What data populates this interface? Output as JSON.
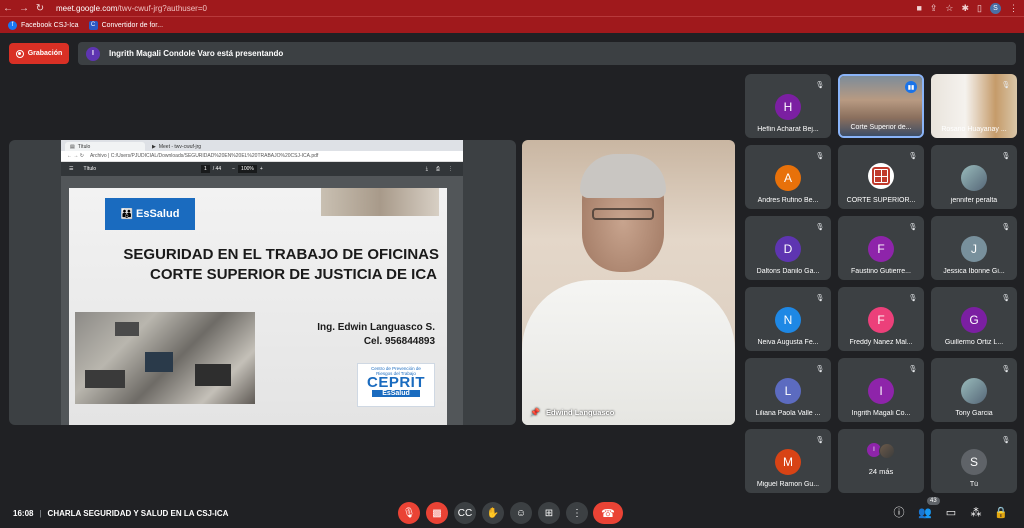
{
  "browser": {
    "url_host": "meet.google.com",
    "url_path": "/twv-cwuf-jrg?authuser=0",
    "profile_initial": "S",
    "bookmarks": [
      {
        "icon": "facebook-icon",
        "label": "Facebook CSJ-Ica"
      },
      {
        "icon": "converter-icon",
        "label": "Convertidor de for..."
      }
    ]
  },
  "meet": {
    "recording_label": "Grabación",
    "presenter_initial": "I",
    "presenting_text": "Ingrith Magali Condole Varo está presentando",
    "accent_red": "#ea4335",
    "tile_bg": "#3c4043"
  },
  "shared_screen": {
    "tab1": "Título",
    "tab2": "Meet - twv-cwuf-jrg",
    "address": "Archivo | C:/Users/PJUDICIAL/Downloads/SEGURIDAD%20EN%20EL%20TRABAJO%20CSJ-ICA.pdf",
    "pdf_title": "Título",
    "page_current": "1",
    "page_total": "/ 44",
    "zoom": "100%",
    "essalud_logo": "EsSalud",
    "title_line1": "SEGURIDAD EN EL TRABAJO DE OFICINAS",
    "title_line2": "CORTE SUPERIOR DE JUSTICIA DE ICA",
    "speaker": "Ing. Edwin Languasco S.",
    "phone": "Cel. 956844893",
    "ceprit_small1": "Centro de Prevención de",
    "ceprit_small2": "Riesgos del Trabajo",
    "ceprit_big": "CEPRIT",
    "ceprit_essalud": "EsSalud"
  },
  "presenter_cam": {
    "name": "Edwind Languasco"
  },
  "participants": [
    {
      "name": "Heflin Acharat Bej...",
      "initial": "H",
      "color": "#7b1fa2",
      "type": "avatar"
    },
    {
      "name": "Corte Superior de...",
      "type": "video-face",
      "active": true
    },
    {
      "name": "Rosario Huayanay ...",
      "type": "video-room"
    },
    {
      "name": "Andres Rufino Be...",
      "initial": "A",
      "color": "#e8710a",
      "type": "avatar"
    },
    {
      "name": "CORTE SUPERIOR...",
      "type": "seal"
    },
    {
      "name": "jennifer peralta",
      "type": "photo"
    },
    {
      "name": "Daltons Danilo Ga...",
      "initial": "D",
      "color": "#5e35b1",
      "type": "avatar"
    },
    {
      "name": "Faustino Gutierre...",
      "initial": "F",
      "color": "#8e24aa",
      "type": "avatar"
    },
    {
      "name": "Jessica Ibonne Gi...",
      "initial": "J",
      "color": "#78909c",
      "type": "avatar"
    },
    {
      "name": "Neiva Augusta Fe...",
      "initial": "N",
      "color": "#1e88e5",
      "type": "avatar"
    },
    {
      "name": "Freddy Nanez Mal...",
      "initial": "F",
      "color": "#ec407a",
      "type": "avatar"
    },
    {
      "name": "Guillermo Ortiz L...",
      "initial": "G",
      "color": "#7b1fa2",
      "type": "avatar"
    },
    {
      "name": "Liliana Paola Valle ...",
      "initial": "L",
      "color": "#5c6bc0",
      "type": "avatar"
    },
    {
      "name": "Ingrith Magali Co...",
      "initial": "I",
      "color": "#8e24aa",
      "type": "avatar"
    },
    {
      "name": "Tony Garcia",
      "type": "photo"
    },
    {
      "name": "Miguel Ramon Gu...",
      "initial": "M",
      "color": "#d84315",
      "type": "avatar"
    },
    {
      "name": "24 más",
      "type": "more"
    },
    {
      "name": "Tú",
      "initial": "S",
      "color": "#5f6368",
      "type": "avatar"
    }
  ],
  "footer": {
    "time": "16:08",
    "separator": "|",
    "meeting_title": "CHARLA SEGURIDAD Y SALUD EN LA CSJ-ICA",
    "people_count": "43"
  }
}
